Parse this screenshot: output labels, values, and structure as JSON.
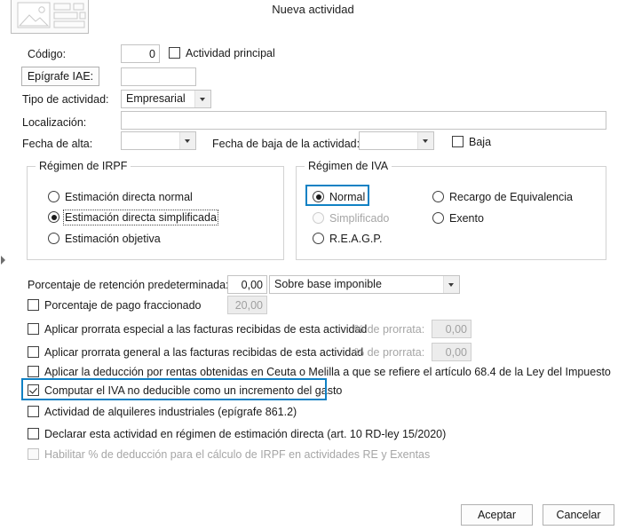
{
  "window": {
    "title": "Nueva actividad",
    "header_icon": "form-image-placeholder-icon",
    "accent_color": "#1081c4",
    "background_color": "#ffffff"
  },
  "fields": {
    "codigo": {
      "label": "Código:",
      "value": "0",
      "placeholder": ""
    },
    "actividad_principal": {
      "label": "Actividad principal",
      "checked": false
    },
    "epigrafe_iae": {
      "button_label": "Epígrafe IAE:",
      "value": "",
      "placeholder": ""
    },
    "tipo_actividad": {
      "label": "Tipo de actividad:",
      "value": "Empresarial",
      "options": [
        "Empresarial"
      ]
    },
    "localizacion": {
      "label": "Localización:",
      "value": "",
      "placeholder": ""
    },
    "fecha_alta": {
      "label": "Fecha de alta:",
      "value": "",
      "placeholder": ""
    },
    "fecha_baja": {
      "label": "Fecha de baja de la actividad:",
      "value": "",
      "placeholder": ""
    },
    "baja": {
      "label": "Baja",
      "checked": false
    }
  },
  "irpf_group": {
    "title": "Régimen de IRPF",
    "options": [
      {
        "label": "Estimación directa normal",
        "selected": false,
        "disabled": false,
        "focused": false
      },
      {
        "label": "Estimación directa simplificada",
        "selected": true,
        "disabled": false,
        "focused": true
      },
      {
        "label": "Estimación objetiva",
        "selected": false,
        "disabled": false,
        "focused": false
      }
    ]
  },
  "iva_group": {
    "title": "Régimen de IVA",
    "options": [
      {
        "label": "Normal",
        "selected": true,
        "disabled": false,
        "highlighted": true
      },
      {
        "label": "Recargo de Equivalencia",
        "selected": false,
        "disabled": false,
        "highlighted": false
      },
      {
        "label": "Simplificado",
        "selected": false,
        "disabled": true,
        "highlighted": false
      },
      {
        "label": "Exento",
        "selected": false,
        "disabled": false,
        "highlighted": false
      },
      {
        "label": "R.E.A.G.P.",
        "selected": false,
        "disabled": false,
        "highlighted": false
      }
    ]
  },
  "retencion": {
    "label": "Porcentaje de retención predeterminada:",
    "value": "0,00",
    "base_select": {
      "value": "Sobre base imponible",
      "options": [
        "Sobre base imponible"
      ]
    }
  },
  "pago_fraccionado": {
    "label": "Porcentaje de pago fraccionado",
    "checked": false,
    "value": "20,00",
    "value_disabled": true
  },
  "prorratas": [
    {
      "label": "Aplicar prorrata especial a las facturas recibidas de esta actividad",
      "checked": false,
      "pct_label": "% de prorrata:",
      "pct_value": "0,00",
      "pct_disabled": true
    },
    {
      "label": "Aplicar prorrata general a las facturas recibidas de esta actividad",
      "checked": false,
      "pct_label": "% de prorrata:",
      "pct_value": "0,00",
      "pct_disabled": true
    }
  ],
  "options_list": [
    {
      "label": "Aplicar la deducción por rentas obtenidas en Ceuta o Melilla a que se refiere el artículo 68.4 de la Ley del Impuesto",
      "checked": false,
      "disabled": false,
      "highlighted": false
    },
    {
      "label": "Computar el IVA no deducible como un incremento del gasto",
      "checked": true,
      "disabled": false,
      "highlighted": true
    },
    {
      "label": "Actividad de alquileres industriales (epígrafe 861.2)",
      "checked": false,
      "disabled": false,
      "highlighted": false
    },
    {
      "label": "Declarar esta actividad en régimen de estimación directa (art. 10 RD-ley 15/2020)",
      "checked": false,
      "disabled": false,
      "highlighted": false
    },
    {
      "label": "Habilitar % de deducción para el cálculo de IRPF en actividades RE y Exentas",
      "checked": false,
      "disabled": true,
      "highlighted": false
    }
  ],
  "footer": {
    "accept_label": "Aceptar",
    "cancel_label": "Cancelar"
  },
  "misc": {
    "left_chevron": "chevron-right-icon"
  }
}
